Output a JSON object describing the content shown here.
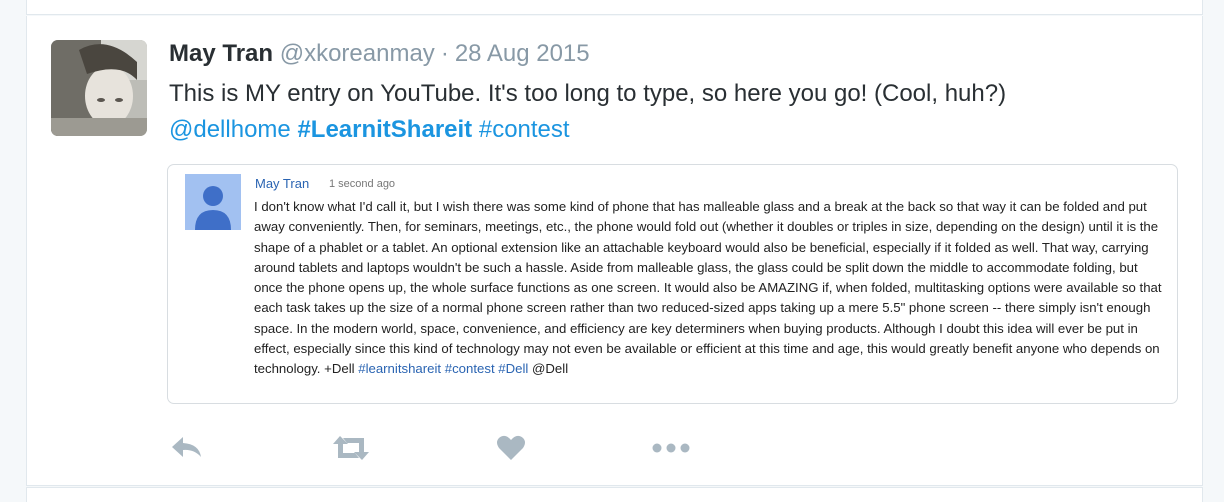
{
  "tweet": {
    "name": "May Tran",
    "handle": "@xkoreanmay",
    "separator": "·",
    "date": "28 Aug 2015",
    "text": "This is MY entry on YouTube. It's too long to type, so here you go! (Cool, huh?)",
    "mention": "@dellhome",
    "hashtag_1": "#LearnitShareit",
    "hashtag_2": "#contest"
  },
  "embedded_comment": {
    "author": "May Tran",
    "timestamp": "1 second ago",
    "body": "I don't know what I'd call it, but I wish there was some kind of phone that has malleable glass and a break at the back so that way it can be folded and put away conveniently. Then, for seminars, meetings, etc., the phone would fold out (whether it doubles or triples in size, depending on the design) until it is the shape of a phablet or a tablet. An optional extension like an attachable keyboard would also be beneficial, especially if it folded as well. That way, carrying around tablets and laptops wouldn't be such a hassle. Aside from malleable glass, the glass could be split down the middle to accommodate folding, but once the phone opens up, the whole surface functions as one screen. It would also be AMAZING if, when folded, multitasking options were available so that each task takes up the size of a normal phone screen rather than two reduced-sized apps taking up a mere 5.5\" phone screen -- there simply isn't enough space. In the modern world, space, convenience, and efficiency are key determiners when buying products. Although I doubt this idea will ever be put in effect, especially since this kind of technology may not even be available or efficient at this time and age, this would greatly benefit anyone who depends on technology. +Dell",
    "tag_1": "#learnitshareit",
    "tag_2": "#contest",
    "tag_3": "#Dell",
    "trailing": "@Dell"
  },
  "actions": [
    "reply-icon",
    "retweet-icon",
    "like-icon",
    "more-icon"
  ],
  "colors": {
    "accent": "#1b95e0",
    "text": "#292f33",
    "muted": "#8899a6",
    "icon": "#aab8c2",
    "google_link": "#2a64b2"
  }
}
